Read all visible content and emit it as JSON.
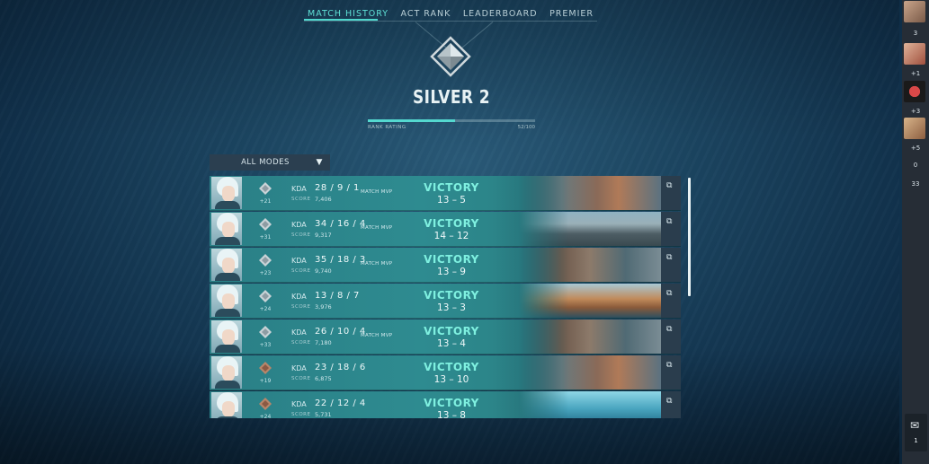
{
  "nav": {
    "tabs": [
      {
        "label": "MATCH HISTORY",
        "active": true
      },
      {
        "label": "ACT RANK",
        "active": false
      },
      {
        "label": "LEADERBOARD",
        "active": false
      },
      {
        "label": "PREMIER",
        "active": false
      }
    ]
  },
  "rank": {
    "title": "SILVER 2",
    "rating_label": "RANK RATING",
    "rating_value": "52/100",
    "rating_fraction": 0.52
  },
  "filter": {
    "selected": "ALL MODES"
  },
  "matches": [
    {
      "rr": "+21",
      "kda_label": "KDA",
      "kda": "28 / 9 / 1",
      "score_label": "SCORE",
      "score": "7,406",
      "mvp": "MATCH MVP",
      "result": "VICTORY",
      "score_line": "13 – 5",
      "tier": "silver",
      "map": "a"
    },
    {
      "rr": "+31",
      "kda_label": "KDA",
      "kda": "34 / 16 / 4",
      "score_label": "SCORE",
      "score": "9,317",
      "mvp": "MATCH MVP",
      "result": "VICTORY",
      "score_line": "14 – 12",
      "tier": "silver",
      "map": "b"
    },
    {
      "rr": "+23",
      "kda_label": "KDA",
      "kda": "35 / 18 / 3",
      "score_label": "SCORE",
      "score": "9,740",
      "mvp": "MATCH MVP",
      "result": "VICTORY",
      "score_line": "13 – 9",
      "tier": "silver",
      "map": "c"
    },
    {
      "rr": "+24",
      "kda_label": "KDA",
      "kda": "13 / 8 / 7",
      "score_label": "SCORE",
      "score": "3,976",
      "mvp": "",
      "result": "VICTORY",
      "score_line": "13 – 3",
      "tier": "silver",
      "map": "d"
    },
    {
      "rr": "+33",
      "kda_label": "KDA",
      "kda": "26 / 10 / 4",
      "score_label": "SCORE",
      "score": "7,180",
      "mvp": "MATCH MVP",
      "result": "VICTORY",
      "score_line": "13 – 4",
      "tier": "silver",
      "map": "c"
    },
    {
      "rr": "+19",
      "kda_label": "KDA",
      "kda": "23 / 18 / 6",
      "score_label": "SCORE",
      "score": "6,875",
      "mvp": "",
      "result": "VICTORY",
      "score_line": "13 – 10",
      "tier": "bronze",
      "map": "a"
    },
    {
      "rr": "+24",
      "kda_label": "KDA",
      "kda": "22 / 12 / 4",
      "score_label": "SCORE",
      "score": "5,731",
      "mvp": "",
      "result": "VICTORY",
      "score_line": "13 – 8",
      "tier": "bronze",
      "map": "e"
    }
  ],
  "social": {
    "counts": [
      "3",
      "+1",
      "+3",
      "+5",
      "0",
      "33"
    ],
    "mail_count": "1"
  },
  "colors": {
    "accent": "#4ed6cc",
    "victory": "#7ff0e0",
    "row": "#2e8b90"
  }
}
